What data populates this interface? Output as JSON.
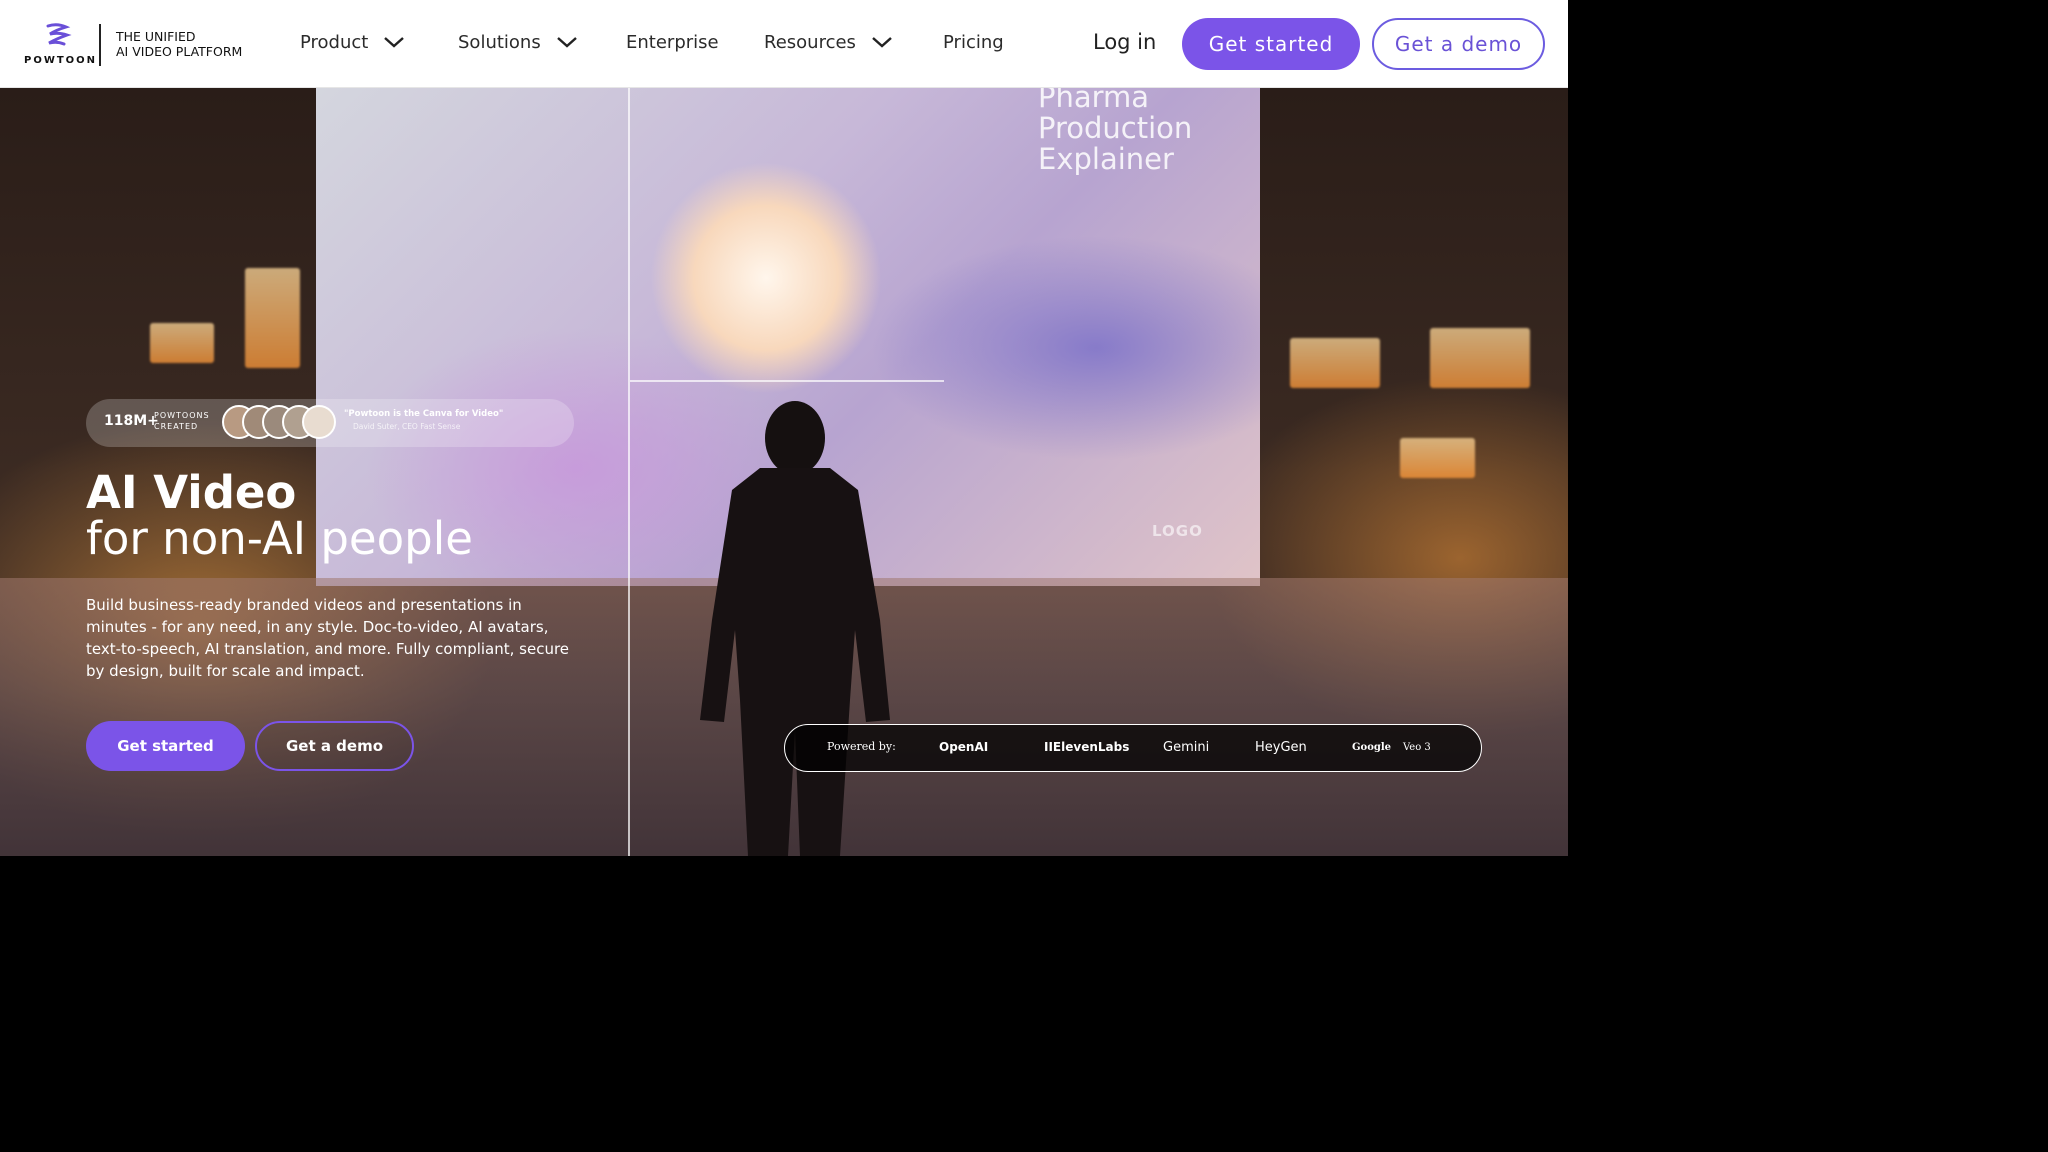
{
  "brand": {
    "logo_word": "POWTOON",
    "tagline_line1": "THE UNIFIED",
    "tagline_line2": "AI VIDEO PLATFORM",
    "accent": "#7b54e8"
  },
  "nav": {
    "items": [
      {
        "label": "Product",
        "has_dropdown": true
      },
      {
        "label": "Solutions",
        "has_dropdown": true
      },
      {
        "label": "Enterprise",
        "has_dropdown": false
      },
      {
        "label": "Resources",
        "has_dropdown": true
      },
      {
        "label": "Pricing",
        "has_dropdown": false
      }
    ],
    "login": "Log in",
    "get_started": "Get started",
    "get_demo": "Get a demo"
  },
  "hero": {
    "screen_title": [
      "Pharma",
      "Production",
      "Explainer"
    ],
    "screen_logo": "LOGO",
    "stats_number": "118M+",
    "stats_label_1": "POWTOONS",
    "stats_label_2": "CREATED",
    "quote": "\"Powtoon is the Canva for Video\"",
    "quote_by": "David Suter, CEO Fast Sense",
    "headline_bold": "AI Video",
    "headline_light": "for non-AI people",
    "description": "Build business-ready branded videos and presentations in minutes - for any need, in any style. Doc-to-video, AI avatars, text-to-speech, AI translation, and more. Fully compliant, secure by design, built for scale and impact.",
    "cta_start": "Get started",
    "cta_demo": "Get a demo"
  },
  "powered_by": {
    "label": "Powered by:",
    "partners": [
      "OpenAI",
      "IIElevenLabs",
      "Gemini",
      "HeyGen",
      "Google",
      "Veo 3"
    ]
  }
}
